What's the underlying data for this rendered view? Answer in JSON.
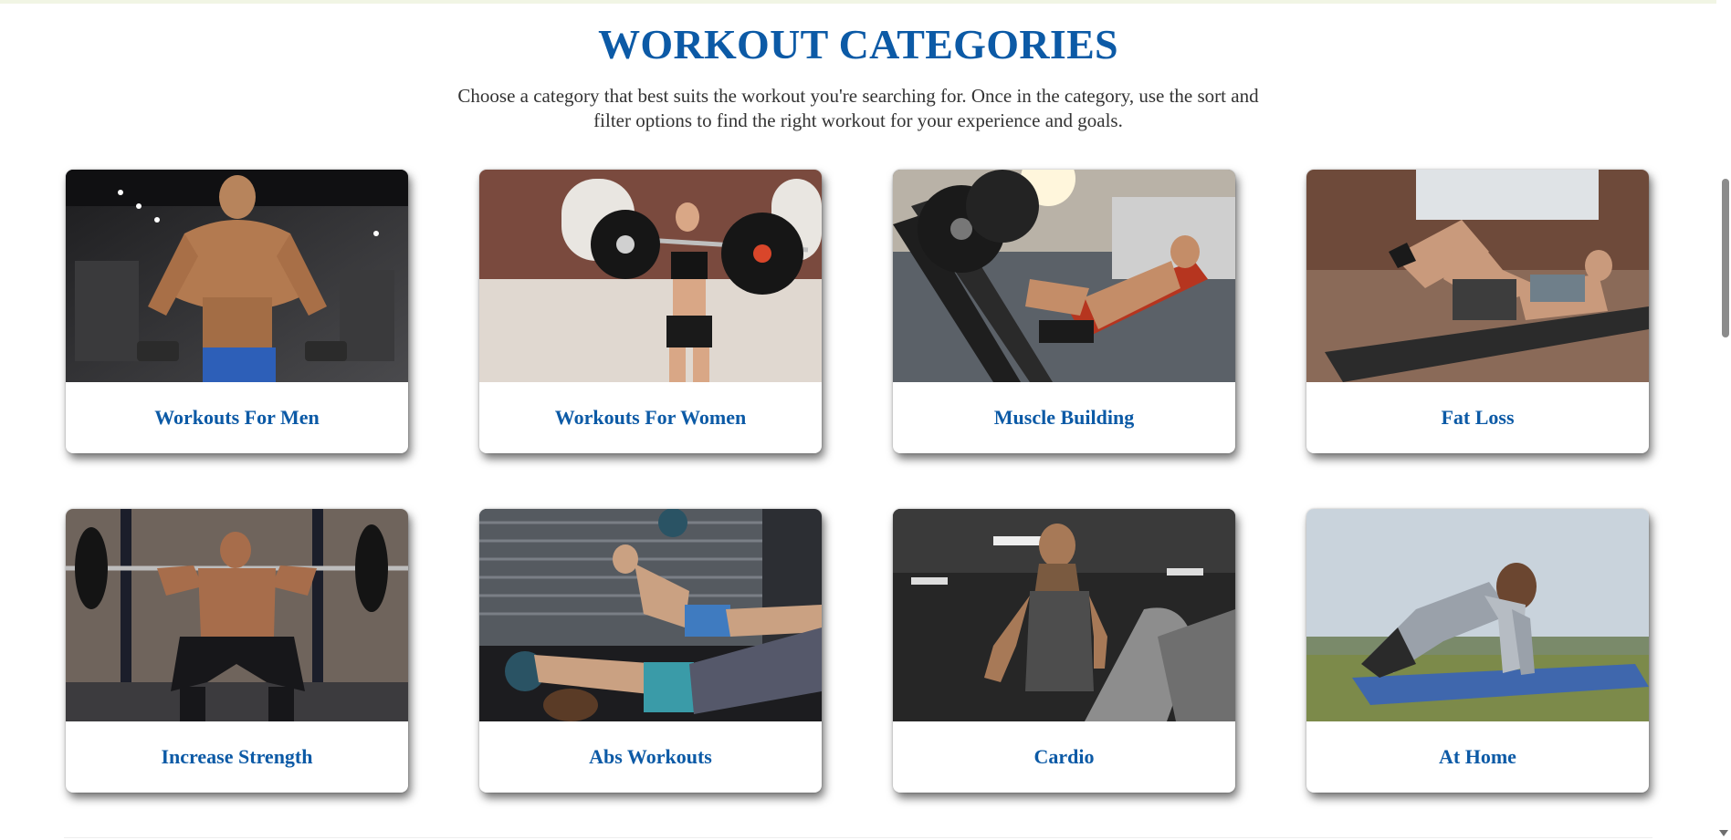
{
  "header": {
    "title": "WORKOUT CATEGORIES",
    "intro": "Choose a category that best suits the workout you're searching for. Once in the category, use the sort and filter options to find the right workout for your experience and goals."
  },
  "categories": [
    {
      "label": "Workouts For Men",
      "image": "man-with-dumbbells-photo"
    },
    {
      "label": "Workouts For Women",
      "image": "woman-with-barbell-photo"
    },
    {
      "label": "Muscle Building",
      "image": "leg-press-machine-photo"
    },
    {
      "label": "Fat Loss",
      "image": "woman-doing-crunches-photo"
    },
    {
      "label": "Increase Strength",
      "image": "man-barbell-squat-photo"
    },
    {
      "label": "Abs Workouts",
      "image": "medicine-ball-situps-photo"
    },
    {
      "label": "Cardio",
      "image": "man-on-treadmill-photo"
    },
    {
      "label": "At Home",
      "image": "man-pushup-outdoors-photo"
    }
  ],
  "colors": {
    "accent": "#0c5aa6",
    "text": "#333333",
    "background": "#ffffff"
  }
}
